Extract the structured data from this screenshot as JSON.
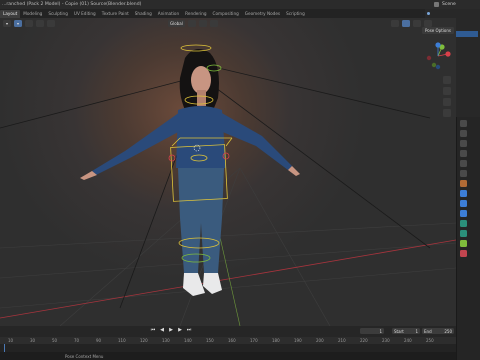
{
  "window": {
    "title": "...ranched (Pack 2 Model) - Copie (01) Source(Blender.blend)",
    "scene_label": "Scene"
  },
  "workspaces": [
    "Layout",
    "Modeling",
    "Sculpting",
    "UV Editing",
    "Texture Paint",
    "Shading",
    "Animation",
    "Rendering",
    "Compositing",
    "Geometry Nodes",
    "Scripting"
  ],
  "active_workspace": "Layout",
  "viewport": {
    "mode": "Global",
    "pose_options": "Pose Options"
  },
  "timeline": {
    "current_frame": "1",
    "start_label": "Start",
    "start": "1",
    "end_label": "End",
    "end": "250",
    "ruler": [
      "10",
      "30",
      "50",
      "70",
      "90",
      "110",
      "120",
      "130",
      "140",
      "150",
      "160",
      "170",
      "180",
      "190",
      "200",
      "210",
      "220",
      "230",
      "240",
      "250"
    ]
  },
  "status": {
    "hint": "Pose Context Menu"
  },
  "colors": {
    "accent": "#4b6fa0",
    "selection": "#2f5b93",
    "armature": "#e0c53a",
    "x_axis": "#d9404a",
    "y_axis": "#7fbd3c",
    "z_axis": "#3d7ed6"
  },
  "icons": {
    "play": "▶",
    "jump_start": "⏮",
    "jump_end": "⏭",
    "prev_key": "◀",
    "next_key": "▶"
  }
}
